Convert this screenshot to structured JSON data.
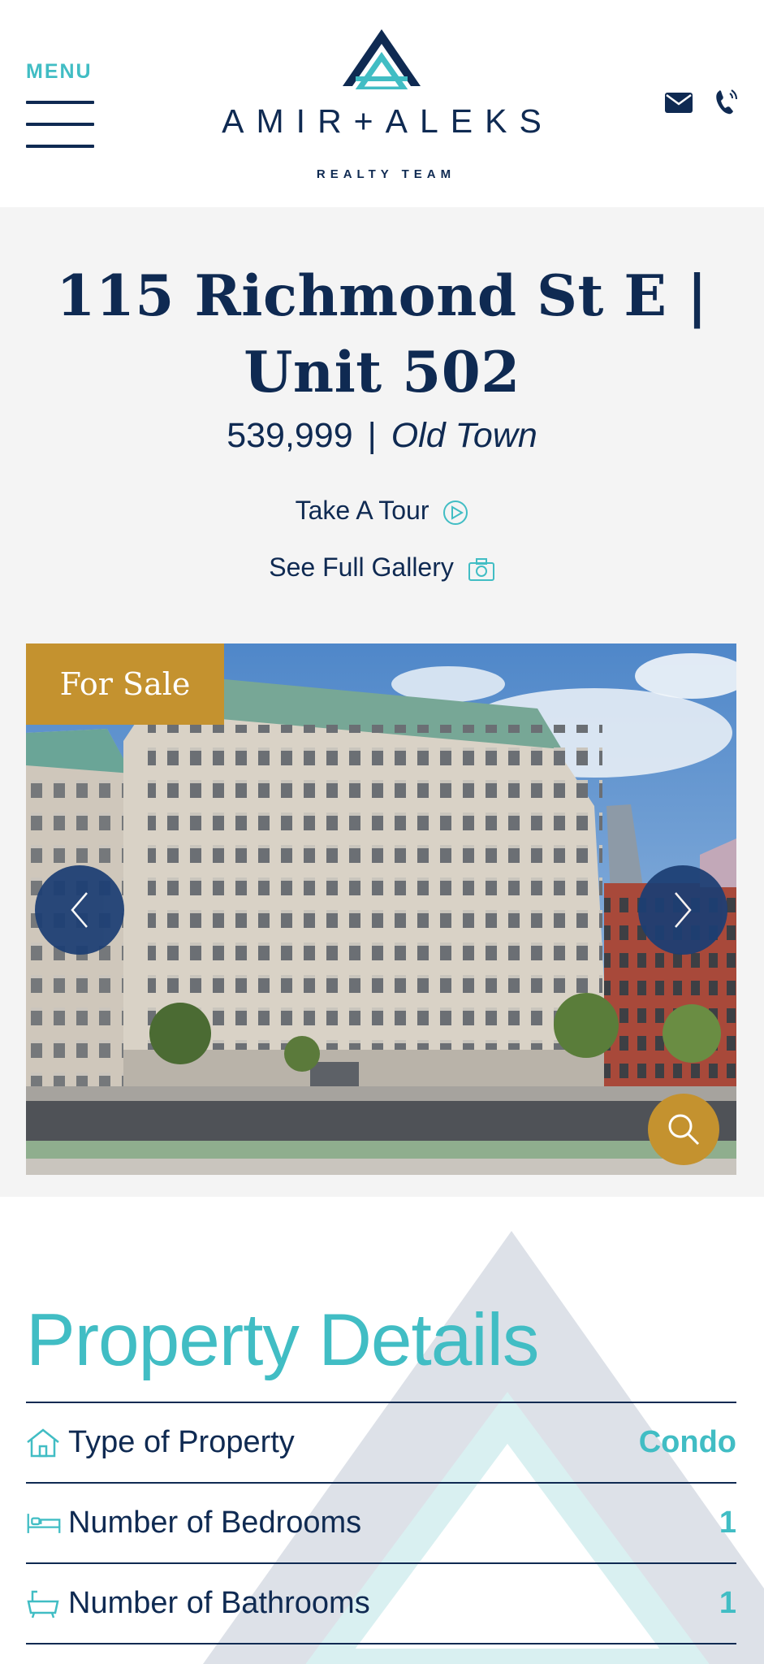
{
  "header": {
    "menu_label": "MENU",
    "brand_name": "AMIR+ALEKS",
    "brand_sub": "REALTY TEAM",
    "colors": {
      "navy": "#0f2a52",
      "teal": "#41bdc4",
      "gold": "#c4922f"
    }
  },
  "listing": {
    "title": "115 Richmond St E | Unit 502",
    "price": "539,999",
    "separator": "|",
    "neighbourhood": "Old Town",
    "tour_link": "Take A Tour",
    "gallery_link": "See Full Gallery",
    "status_badge": "For Sale"
  },
  "details": {
    "heading": "Property Details",
    "rows": [
      {
        "label": "Type of Property",
        "value": "Condo",
        "icon": "house-icon"
      },
      {
        "label": "Number of Bedrooms",
        "value": "1",
        "icon": "bed-icon"
      },
      {
        "label": "Number of Bathrooms",
        "value": "1",
        "icon": "bathtub-icon"
      }
    ]
  }
}
